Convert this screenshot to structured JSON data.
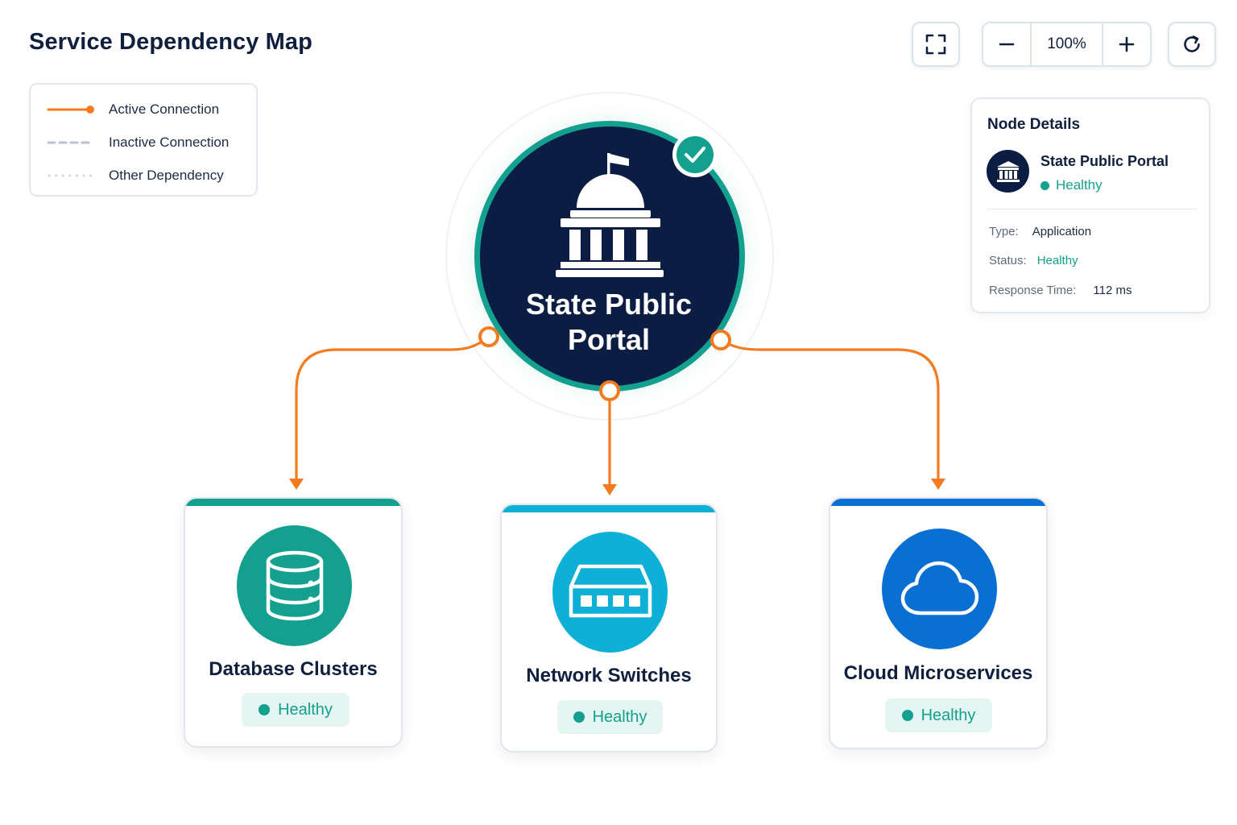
{
  "header": {
    "title": "Service Dependency Map"
  },
  "toolbar": {
    "zoom_level": "100%"
  },
  "legend": {
    "items": [
      {
        "label": "Active Connection",
        "style": "solid",
        "color": "#f47b20"
      },
      {
        "label": "Inactive Connection",
        "style": "dashed",
        "color": "#b9c3d2"
      },
      {
        "label": "Other Dependency",
        "style": "dotted",
        "color": "#cfd6e0"
      }
    ]
  },
  "hub": {
    "name_line1": "State Public",
    "name_line2": "Portal",
    "icon": "capitol-building-icon",
    "status": "Healthy",
    "ring_color": "#14a08f",
    "fill_color": "#0b1d43"
  },
  "nodes": [
    {
      "label": "Database Clusters",
      "status": "Healthy",
      "icon": "database-icon",
      "color": "#14a08f"
    },
    {
      "label": "Network Switches",
      "status": "Healthy",
      "icon": "network-switch-icon",
      "color": "#0fb0d8"
    },
    {
      "label": "Cloud Microservices",
      "status": "Healthy",
      "icon": "cloud-icon",
      "color": "#0a6fd3"
    }
  ],
  "details": {
    "title": "Node Details",
    "name": "State Public Portal",
    "status": "Healthy",
    "type_label": "Type:",
    "type_value": "Application",
    "status_label": "Status:",
    "status_value": "Healthy",
    "response_label": "Response Time:",
    "response_value": "112 ms"
  },
  "colors": {
    "connection": "#f47b20",
    "healthy": "#13a08e",
    "text_primary": "#0f1f3d"
  }
}
